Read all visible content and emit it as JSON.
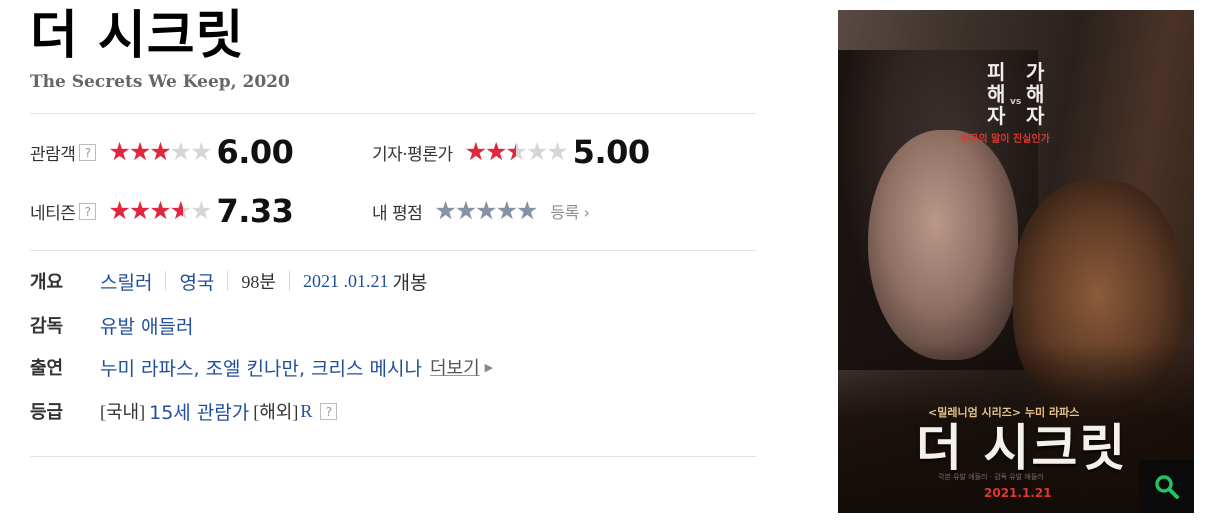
{
  "movie": {
    "title": "더 시크릿",
    "subtitle": "The Secrets We Keep, 2020"
  },
  "ratings": {
    "audience": {
      "label": "관람객",
      "help": "?",
      "score": "6.00",
      "fraction": 0.6
    },
    "critics": {
      "label": "기자·평론가",
      "score": "5.00",
      "fraction": 0.5
    },
    "netizen": {
      "label": "네티즌",
      "help": "?",
      "score": "7.33",
      "fraction": 0.733
    },
    "my_rating": {
      "label": "내 평점",
      "fraction": 1.0,
      "enroll_label": "등록",
      "enroll_arrow": "›"
    }
  },
  "stars_glyphs": "★★★★★",
  "details": {
    "overview": {
      "label": "개요",
      "genre": "스릴러",
      "country": "영국",
      "runtime": "98분",
      "release_date": "2021 .01.21",
      "release_suffix": "개봉"
    },
    "director": {
      "label": "감독",
      "name": "유발 애들러"
    },
    "cast": {
      "label": "출연",
      "names": "누미 라파스, 조엘 킨나만, 크리스 메시나",
      "more_label": "더보기",
      "more_arrow": "▶"
    },
    "rating_grade": {
      "label": "등급",
      "domestic_prefix": "[국내]",
      "domestic_value": "15세 관람가",
      "foreign_prefix": "[해외]",
      "foreign_value": "R",
      "help": "?"
    }
  },
  "poster": {
    "tag_left_1": "피",
    "tag_left_2": "해",
    "tag_left_3": "자",
    "tag_vs": "vs",
    "tag_right_1": "가",
    "tag_right_2": "해",
    "tag_right_3": "자",
    "tagline": "누구의 말이 진실인가",
    "subline": "<밀레니엄 시리즈> 누미 라파스",
    "title": "더 시크릿",
    "credits": "각본 유발 애들러 · 감독 유발 애들러",
    "date": "2021.1.21"
  },
  "colors": {
    "star_red": "#e2263f",
    "star_blue": "#8493a6",
    "star_empty": "#d6d6d6",
    "link": "#1f4f9e"
  },
  "icons": {
    "zoom": "magnifier-icon"
  }
}
